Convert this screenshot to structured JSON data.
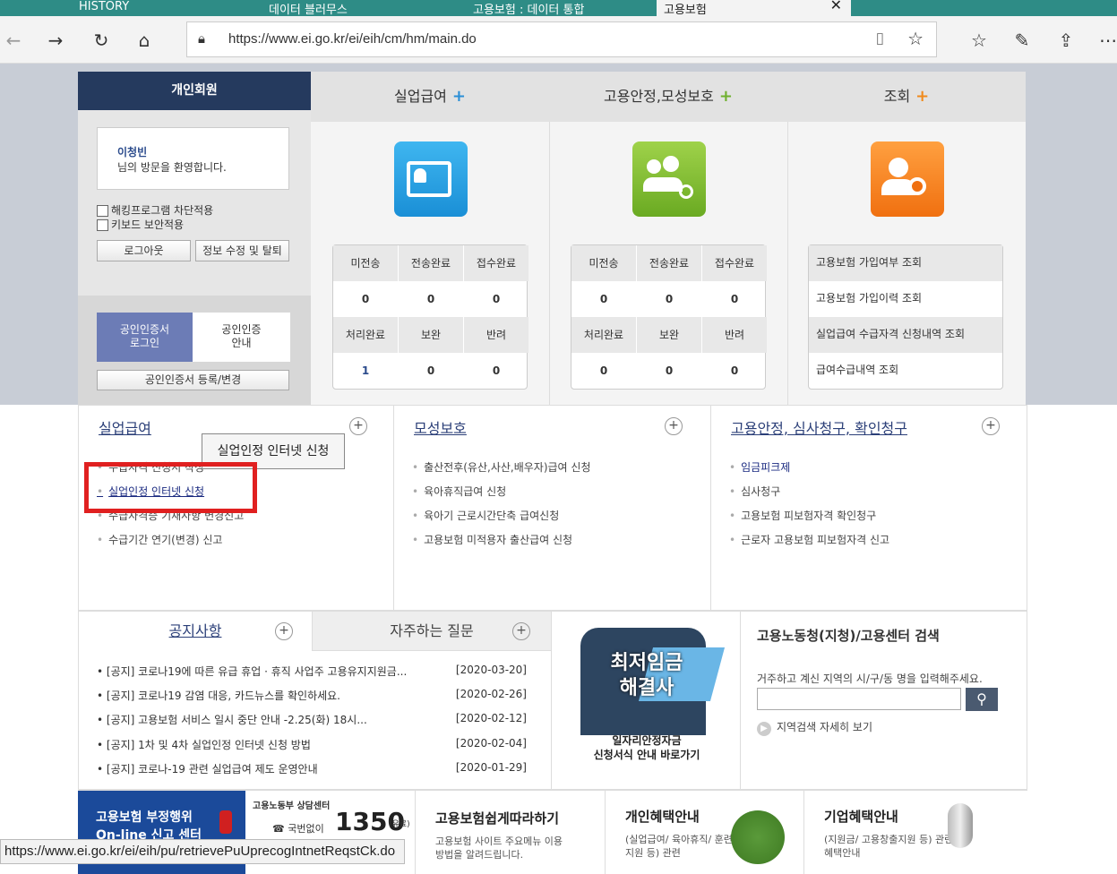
{
  "browser": {
    "tabs": [
      {
        "label": "HISTORY"
      },
      {
        "label": "데이터 블러무스"
      },
      {
        "label": "고용보험 : 데이터 통합"
      },
      {
        "label": "고용보험"
      }
    ],
    "url": "https://www.ei.go.kr/ei/eih/cm/hm/main.do",
    "status_url": "https://www.ei.go.kr/ei/eih/pu/retrievePuUprecogIntnetReqstCk.do"
  },
  "login": {
    "header": "개인회원",
    "user_name": "이청빈",
    "welcome": "님의 방문을 환영합니다.",
    "check1": "해킹프로그램 차단적용",
    "check2": "키보드 보안적용",
    "logout": "로그아웃",
    "edit": "정보 수정 및 탈퇴",
    "cert_login_1": "공인인증서",
    "cert_login_2": "로그인",
    "cert_guide_1": "공인인증",
    "cert_guide_2": "안내",
    "cert_register": "공인인증서 등록/변경"
  },
  "services": {
    "col1_title": "실업급여",
    "col2_title": "고용안정,모성보호",
    "col3_title": "조회",
    "stat_labels": [
      "미전송",
      "전송완료",
      "접수완료",
      "처리완료",
      "보완",
      "반려"
    ],
    "col1_values": [
      "0",
      "0",
      "0",
      "1",
      "0",
      "0"
    ],
    "col2_values": [
      "0",
      "0",
      "0",
      "0",
      "0",
      "0"
    ],
    "queries": [
      "고용보험 가입여부 조회",
      "고용보험 가입이력 조회",
      "실업급여 수급자격 신청내역 조회",
      "급여수급내역 조회"
    ]
  },
  "menus": {
    "m1_title": "실업급여",
    "m1_items": [
      "수급자격 신청서 작성",
      "실업인정 인터넷 신청",
      "수급자격증 기재사항 변경신고",
      "수급기간 연기(변경) 신고"
    ],
    "m2_title": "모성보호",
    "m2_items": [
      "출산전후(유산,사산,배우자)급여 신청",
      "육아휴직급여 신청",
      "육아기 근로시간단축 급여신청",
      "고용보험 미적용자 출산급여 신청"
    ],
    "m3_title": "고용안정, 심사청구, 확인청구",
    "m3_items": [
      "임금피크제",
      "심사청구",
      "고용보험 피보험자격 확인청구",
      "근로자 고용보험 피보험자격 신고"
    ],
    "tooltip": "실업인정 인터넷 신청"
  },
  "notices": {
    "tab1": "공지사항",
    "tab2": "자주하는 질문",
    "items": [
      {
        "title": "[공지] 코로나19에 따른 유급 휴업 · 휴직 사업주 고용유지지원금...",
        "date": "[2020-03-20]"
      },
      {
        "title": "[공지] 코로나19 감염 대응, 카드뉴스를 확인하세요.",
        "date": "[2020-02-26]"
      },
      {
        "title": "[공지] 고용보험 서비스 일시 중단 안내 -2.25(화) 18시...",
        "date": "[2020-02-12]"
      },
      {
        "title": "[공지] 1차 및 4차 실업인정 인터넷 신청 방법",
        "date": "[2020-02-04]"
      },
      {
        "title": "[공지] 코로나-19 관련 실업급여 제도 운영안내",
        "date": "[2020-01-29]"
      }
    ]
  },
  "promo": {
    "headline_1": "최저임금",
    "headline_2": "해결사",
    "sub_1": "일자리안정자금",
    "sub_2": "신청서식 안내 바로가기"
  },
  "center_search": {
    "title": "고용노동청(지청)/고용센터 검색",
    "desc": "거주하고 계신 지역의 시/구/동 명을 입력해주세요.",
    "placeholder": "",
    "detail": "지역검색 자세히 보기"
  },
  "banners": {
    "b1_1": "고용보험 부정행위",
    "b1_2": "On-line 신고 센터",
    "b2_1": "고용노동부 상담센터",
    "b2_num": "1350",
    "b2_sub": "국번없이",
    "b2_tag": "(유료)",
    "b3_title": "고용보험쉽게따라하기",
    "b3_desc": "고용보험 사이트 주요메뉴 이용방법을 알려드립니다.",
    "b4_title": "개인혜택안내",
    "b4_desc": "(실업급여/ 육아휴직/ 훈련지원 등) 관련",
    "b5_title": "기업혜택안내",
    "b5_desc": "(지원금/ 고용창출지원 등) 관련 혜택안내"
  }
}
